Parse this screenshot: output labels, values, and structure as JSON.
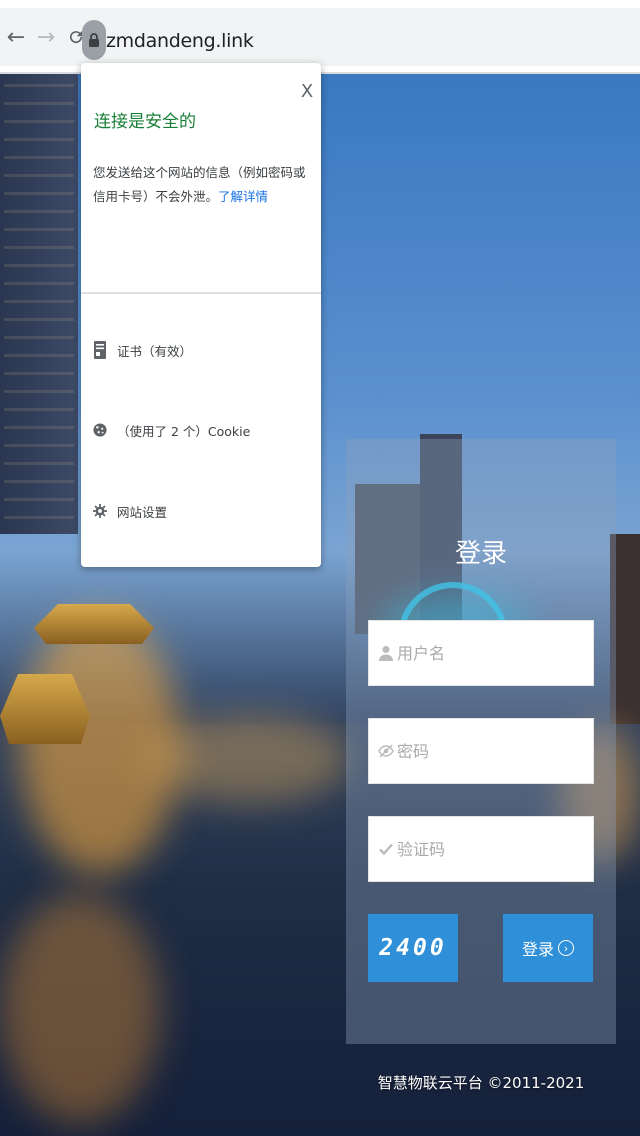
{
  "browser": {
    "url": "zmdandeng.link",
    "back_icon": "←",
    "forward_icon": "→",
    "reload_icon": "C"
  },
  "security_popup": {
    "title": "连接是安全的",
    "description": "您发送给这个网站的信息（例如密码或信用卡号）不会外泄。",
    "learn_more": "了解详情",
    "close": "X",
    "items": [
      {
        "icon": "certificate-icon",
        "label": "证书（有效）"
      },
      {
        "icon": "cookie-icon",
        "label": "（使用了 2 个）Cookie"
      },
      {
        "icon": "gear-icon",
        "label": "网站设置"
      }
    ]
  },
  "login": {
    "title": "登录",
    "username_placeholder": "用户名",
    "password_placeholder": "密码",
    "captcha_placeholder": "验证码",
    "captcha_image_text": "2400",
    "submit_label": "登录"
  },
  "footer": {
    "text": "智慧物联云平台 ©2011-2021"
  },
  "colors": {
    "accent": "#2f8fd8",
    "secure_green": "#188038",
    "link_blue": "#1a73e8"
  }
}
